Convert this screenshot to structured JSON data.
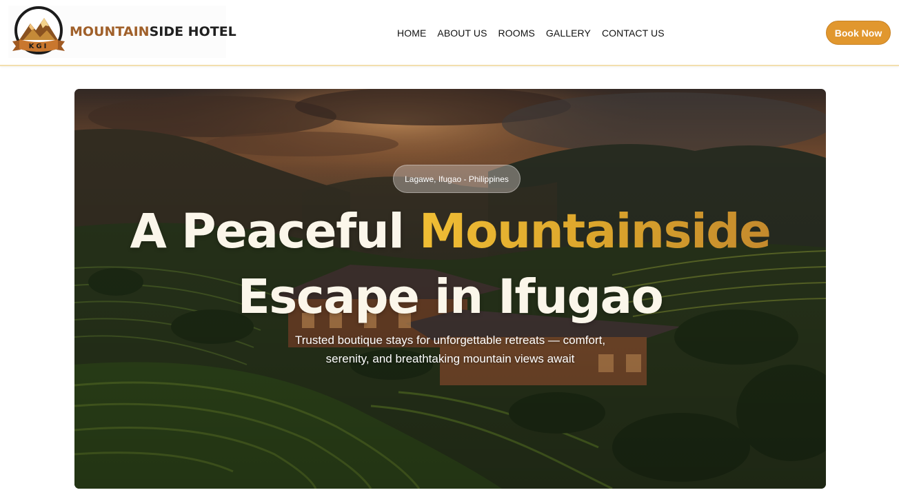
{
  "brand": {
    "emblem_text": "KGI",
    "name_part_a": "MOUNTAIN",
    "name_part_b": "SIDE HOTEL",
    "accent_color": "#a0602a"
  },
  "nav": {
    "items": [
      {
        "label": "HOME"
      },
      {
        "label": "ABOUT US"
      },
      {
        "label": "ROOMS"
      },
      {
        "label": "GALLERY"
      },
      {
        "label": "CONTACT US"
      }
    ]
  },
  "cta": {
    "book_label": "Book Now",
    "color": "#e1972e"
  },
  "hero": {
    "location": "Lagawe, Ifugao - Philippines",
    "headline_part1": "A Peaceful ",
    "headline_highlight": "Mountainside",
    "headline_part2": "Escape in Ifugao",
    "subtitle_line1": "Trusted boutique stays for unforgettable retreats — comfort,",
    "subtitle_line2": "serenity, and breathtaking mountain views await",
    "highlight_color": "#e8b133",
    "image_description_icon": "rice-terraces-resort-photo"
  }
}
